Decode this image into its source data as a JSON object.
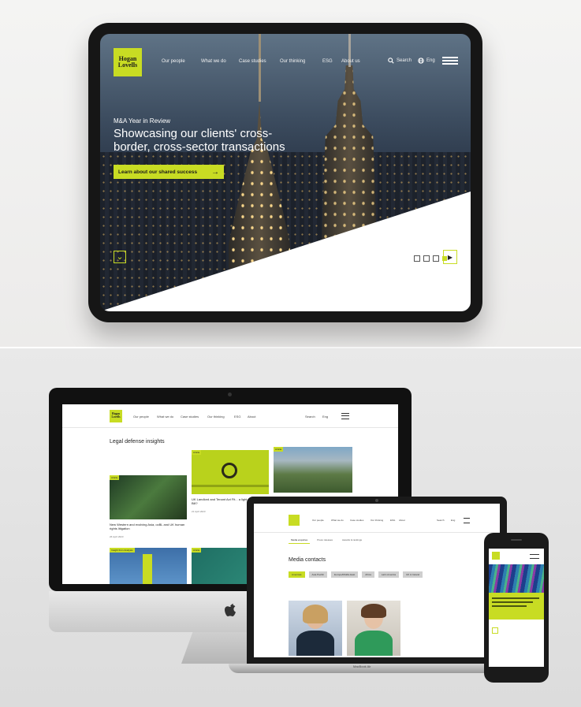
{
  "tablet": {
    "logo_line1": "Hogan",
    "logo_line2": "Lovells",
    "nav": [
      "Our people",
      "What we do",
      "Case studies",
      "Our thinking",
      "ESG",
      "About us"
    ],
    "search_label": "Search",
    "language_label": "Eng",
    "hero_eyebrow": "M&A Year in Review",
    "hero_title_line1": "Showcasing our clients' cross-",
    "hero_title_line2": "border, cross-sector transactions",
    "cta_label": "Learn about our shared success",
    "cta_arrow": "→",
    "scroll_down_glyph": "⌄",
    "play_glyph": "▶"
  },
  "imac": {
    "logo_line1": "Hogan",
    "logo_line2": "Lovells",
    "nav": [
      "Our people",
      "What we do",
      "Case studies",
      "Our thinking",
      "ESG",
      "About"
    ],
    "search_label": "Search",
    "language_label": "Eng",
    "section_title": "Legal defense insights",
    "cards": [
      {
        "label": "Article",
        "title": "New Western and evolving Asia, ocBL and UK human rights litigation",
        "date": "26 April 2023"
      },
      {
        "label": "Article",
        "title": "UK Landlord and Tenant Act Fit... a light refresh laid Bill?",
        "date": "21 April 2023"
      },
      {
        "label": "Article",
        "title": "",
        "date": ""
      },
      {
        "label": "Insight from Analysis",
        "title": "",
        "date": ""
      },
      {
        "label": "Article",
        "title": "",
        "date": ""
      }
    ],
    "apple_logo": ""
  },
  "laptop": {
    "nav": [
      "Our people",
      "What we do",
      "Case studies",
      "Our thinking",
      "ESG",
      "About"
    ],
    "search_label": "Search",
    "language_label": "Eng",
    "tabs": [
      "Media enquiries",
      "Press releases",
      "Awards & rankings"
    ],
    "section_title": "Media contacts",
    "filters": [
      "Americas",
      "Asia Pacific",
      "Europe/Middle East",
      "Africa",
      "Latin America",
      "UK & Ireland"
    ],
    "model_label": "MacBook Air"
  },
  "colors": {
    "accent": "#c8dc23",
    "dark": "#161616"
  }
}
